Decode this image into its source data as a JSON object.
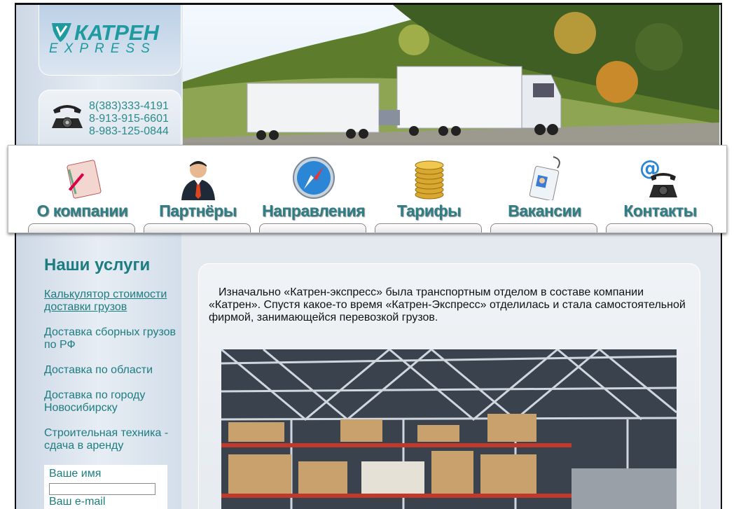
{
  "brand": {
    "name": "КАТРЕН",
    "sub": "EXPRESS"
  },
  "phones": [
    "8(383)333-4191",
    "8-913-915-6601",
    "8-983-125-0844"
  ],
  "nav": [
    {
      "label": "О компании",
      "icon": "notebook-icon"
    },
    {
      "label": "Партнёры",
      "icon": "businessman-icon"
    },
    {
      "label": "Направления",
      "icon": "compass-icon"
    },
    {
      "label": "Тарифы",
      "icon": "coins-icon"
    },
    {
      "label": "Вакансии",
      "icon": "badge-icon"
    },
    {
      "label": "Контакты",
      "icon": "email-phone-icon"
    }
  ],
  "sidebar": {
    "title": "Наши услуги",
    "services": [
      "Калькулятор стоимости доставки грузов",
      "Доставка сборных грузов по РФ",
      "Доставка по области",
      "Доставка по городу Новосибирску",
      "Строительная техника - сдача в аренду"
    ]
  },
  "form": {
    "name_label": "Ваше имя",
    "email_label": "Ваш e-mail"
  },
  "main": {
    "intro": "Изначально «Катрен-экспресс» была транспортным отделом в составе компании «Катрен». Спустя какое-то время «Катрен-Экспресс» отделилась и стала самостоятельной фирмой, занимающейся перевозкой грузов."
  },
  "colors": {
    "accent": "#1c7d80",
    "nav_text": "#2e7e86"
  }
}
